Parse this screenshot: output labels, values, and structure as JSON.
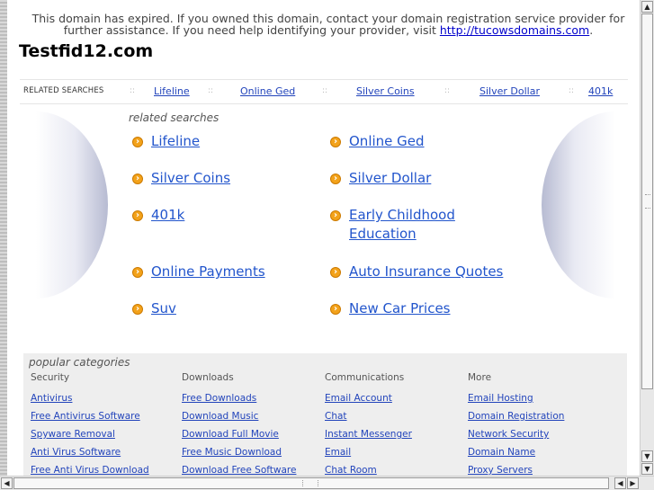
{
  "notice": {
    "text": "This domain has expired. If you owned this domain, contact your domain registration service provider for further assistance. If you need help identifying your provider, visit ",
    "link": "http://tucowsdomains.com",
    "suffix": "."
  },
  "site_title": "Testfid12.com",
  "related_bar": {
    "label": "RELATED SEARCHES",
    "separator": "::",
    "links": [
      "Lifeline",
      "Online Ged",
      "Silver Coins",
      "Silver Dollar",
      "401k"
    ]
  },
  "related_searches": {
    "title": "related searches",
    "left": [
      "Lifeline",
      "Silver Coins",
      "401k",
      "Online Payments",
      "Suv"
    ],
    "right": [
      "Online Ged",
      "Silver Dollar",
      "Early Childhood Education",
      "Auto Insurance Quotes",
      "New Car Prices"
    ]
  },
  "popular": {
    "title": "popular categories",
    "columns": [
      {
        "heading": "Security",
        "links": [
          "Antivirus",
          "Free Antivirus Software",
          "Spyware Removal",
          "Anti Virus Software",
          "Free Anti Virus Download"
        ]
      },
      {
        "heading": "Downloads",
        "links": [
          "Free Downloads",
          "Download Music",
          "Download Full Movie",
          "Free Music Download",
          "Download Free Software"
        ]
      },
      {
        "heading": "Communications",
        "links": [
          "Email Account",
          "Chat",
          "Instant Messenger",
          "Email",
          "Chat Room"
        ]
      },
      {
        "heading": "More",
        "links": [
          "Email Hosting",
          "Domain Registration",
          "Network Security",
          "Domain Name",
          "Proxy Servers"
        ]
      }
    ]
  },
  "icons": {
    "arrow": "arrow-circle-icon",
    "scroll_up": "▲",
    "scroll_down": "▼",
    "scroll_left": "◀",
    "scroll_right": "▶"
  },
  "colors": {
    "link": "#2255cc",
    "arrow": "#f3a21a"
  }
}
